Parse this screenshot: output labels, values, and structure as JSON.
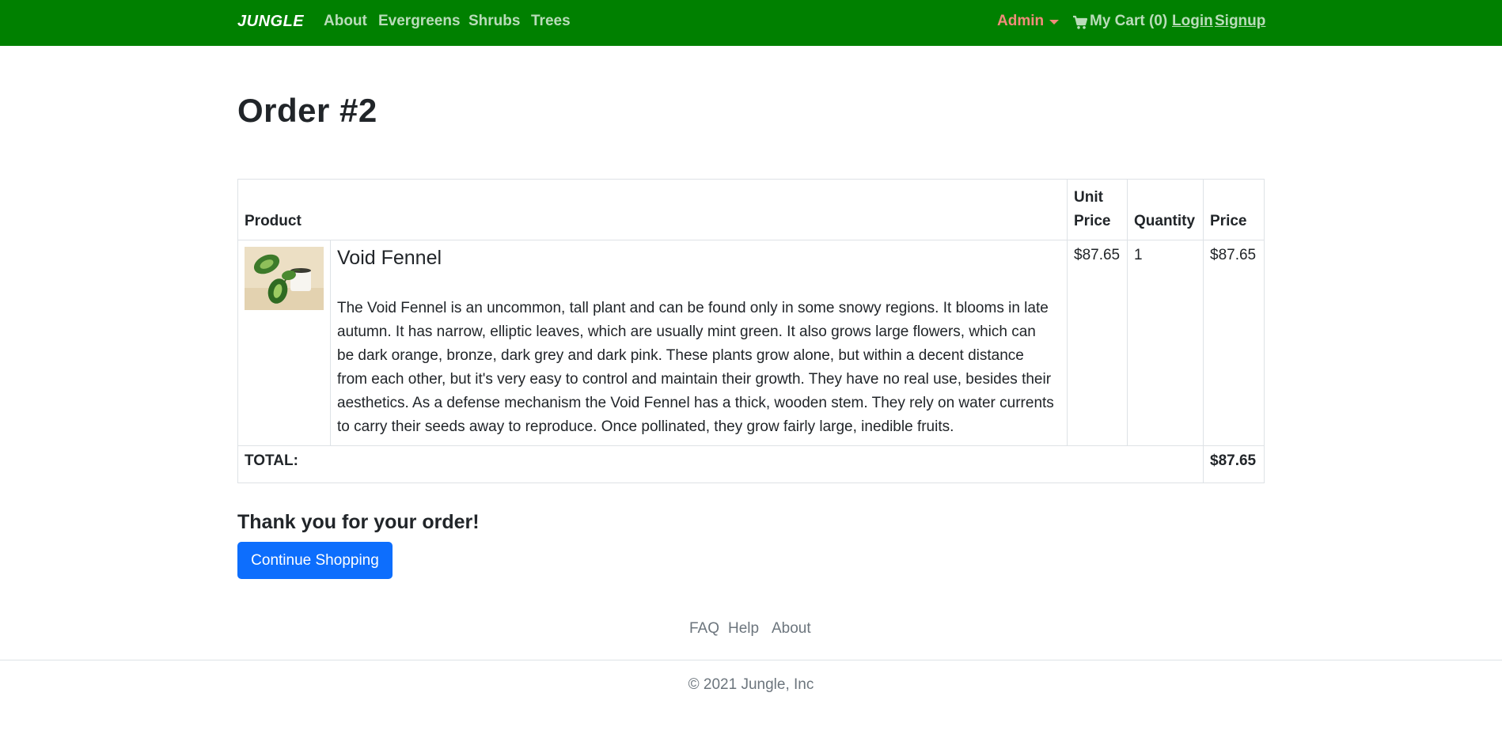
{
  "navbar": {
    "brand": "JUNGLE",
    "links": [
      "About",
      "Evergreens",
      "Shrubs",
      "Trees"
    ],
    "admin_label": "Admin",
    "cart_label": "My Cart (0)",
    "login_label": "Login",
    "signup_label": "Signup",
    "colors": {
      "background": "#008000",
      "admin": "#f08c7a",
      "link": "#b9dcb9"
    }
  },
  "page": {
    "title": "Order #2"
  },
  "table": {
    "headers": [
      "Product",
      "Unit Price",
      "Quantity",
      "Price"
    ],
    "items": [
      {
        "name": "Void Fennel",
        "description": "The Void Fennel is an uncommon, tall plant and can be found only in some snowy regions. It blooms in late autumn. It has narrow, elliptic leaves, which are usually mint green. It also grows large flowers, which can be dark orange, bronze, dark grey and dark pink. These plants grow alone, but within a decent distance from each other, but it's very easy to control and maintain their growth. They have no real use, besides their aesthetics. As a defense mechanism the Void Fennel has a thick, wooden stem. They rely on water currents to carry their seeds away to reproduce. Once pollinated, they grow fairly large, inedible fruits.",
        "unit_price": "$87.65",
        "quantity": "1",
        "price": "$87.65"
      }
    ],
    "total_label": "TOTAL:",
    "total_value": "$87.65"
  },
  "confirmation": {
    "thanks": "Thank you for your order!",
    "continue_label": "Continue Shopping",
    "button_color": "#0d6efd"
  },
  "footer": {
    "links": [
      "FAQ",
      "Help",
      "About"
    ],
    "copyright": "© 2021 Jungle, Inc"
  }
}
